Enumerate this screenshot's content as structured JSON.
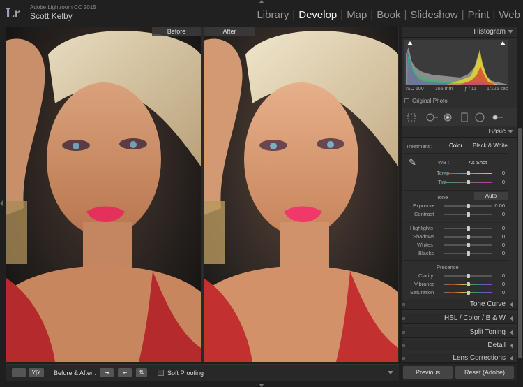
{
  "app": {
    "logo": "Lr",
    "app_name": "Adobe Lightroom CC 2015",
    "user_name": "Scott Kelby"
  },
  "modules": [
    {
      "label": "Library",
      "active": false
    },
    {
      "label": "Develop",
      "active": true
    },
    {
      "label": "Map",
      "active": false
    },
    {
      "label": "Book",
      "active": false
    },
    {
      "label": "Slideshow",
      "active": false
    },
    {
      "label": "Print",
      "active": false
    },
    {
      "label": "Web",
      "active": false
    }
  ],
  "view": {
    "before_label": "Before",
    "after_label": "After"
  },
  "toolbar": {
    "yy_label": "Y|Y",
    "before_after_label": "Before & After :",
    "soft_proofing_label": "Soft Proofing",
    "soft_proofing_checked": false
  },
  "histogram": {
    "title": "Histogram",
    "iso": "ISO 100",
    "focal": "165 mm",
    "aperture": "ƒ / 11",
    "shutter": "1/125 sec",
    "original_photo_label": "Original Photo"
  },
  "basic": {
    "title": "Basic",
    "treatment_label": "Treatment :",
    "treatment_color": "Color",
    "treatment_bw": "Black & White",
    "wb_label": "WB :",
    "wb_value": "As Shot",
    "tone_label": "Tone",
    "auto_label": "Auto",
    "presence_label": "Presence",
    "sliders": [
      {
        "name": "temp",
        "label": "Temp",
        "value": "0",
        "position": 0.5
      },
      {
        "name": "tint",
        "label": "Tint",
        "value": "0",
        "position": 0.5
      },
      {
        "name": "exposure",
        "label": "Exposure",
        "value": "0.00",
        "position": 0.5
      },
      {
        "name": "contrast",
        "label": "Contrast",
        "value": "0",
        "position": 0.5
      },
      {
        "name": "highlights",
        "label": "Highlights",
        "value": "0",
        "position": 0.5
      },
      {
        "name": "shadows",
        "label": "Shadows",
        "value": "0",
        "position": 0.5
      },
      {
        "name": "whites",
        "label": "Whites",
        "value": "0",
        "position": 0.5
      },
      {
        "name": "blacks",
        "label": "Blacks",
        "value": "0",
        "position": 0.5
      },
      {
        "name": "clarity",
        "label": "Clarity",
        "value": "0",
        "position": 0.5
      },
      {
        "name": "vibrance",
        "label": "Vibrance",
        "value": "0",
        "position": 0.5
      },
      {
        "name": "saturation",
        "label": "Saturation",
        "value": "0",
        "position": 0.5
      }
    ]
  },
  "panels": [
    {
      "name": "tone-curve",
      "label": "Tone Curve"
    },
    {
      "name": "hsl",
      "label": "HSL  /  Color  /  B & W"
    },
    {
      "name": "split-toning",
      "label": "Split Toning"
    },
    {
      "name": "detail",
      "label": "Detail"
    },
    {
      "name": "lens-corrections",
      "label": "Lens Corrections"
    }
  ],
  "bottom": {
    "previous_label": "Previous",
    "reset_label": "Reset (Adobe)"
  },
  "colors": {
    "accent": "#f0f0f0",
    "panel_bg": "#2e2e2e"
  }
}
